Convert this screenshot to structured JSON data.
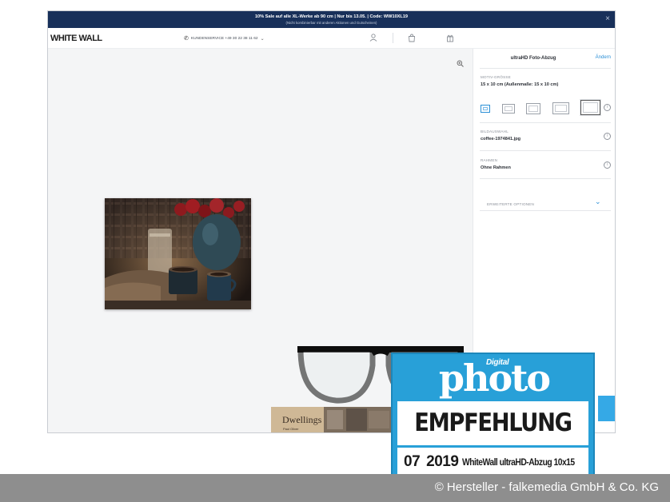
{
  "promo": {
    "line1": "10% Sale auf alle XL-Werke ab 90 cm | Nur bis 13.05. | Code: WW10XL19",
    "line2": "(Nicht kombinierbar mit anderen Aktionen und Gutscheinen)",
    "close": "×"
  },
  "header": {
    "logo": "WHITE WALL",
    "hotline": "KUNDENSERVICE +49 30 22 38 11 62",
    "icons": [
      "account-icon",
      "bag-icon",
      "gift-icon"
    ]
  },
  "canvas": {
    "zoom_icon": "zoom-icon",
    "photo": "coffee still life"
  },
  "panel": {
    "title": "ultraHD Foto-Abzug",
    "change": "Ändern",
    "size_label": "MOTIV-GRÖSSE",
    "size_value": "15 x 10 cm (Außenmaße: 15 x 10 cm)",
    "image_label": "BILDAUSWAHL",
    "image_value": "coffee-1974841.jpg",
    "frame_label": "RAHMEN",
    "frame_value": "Ohne Rahmen",
    "advanced": "ERWEITERTE OPTIONEN",
    "info": "i"
  },
  "badge": {
    "digital": "Digital",
    "photo": "photo",
    "recommendation": "EMPFEHLUNG",
    "issue": "07",
    "year": "2019",
    "product": "WhiteWall ultraHD-Abzug 10x15"
  },
  "book": {
    "title": "Dwellings",
    "author": "Paul Oliver"
  },
  "credit": "© Hersteller - falkemedia GmbH & Co. KG",
  "colors": {
    "promo_bg": "#18305a",
    "accent": "#2a8fd6",
    "badge_blue": "#28a0d8"
  }
}
